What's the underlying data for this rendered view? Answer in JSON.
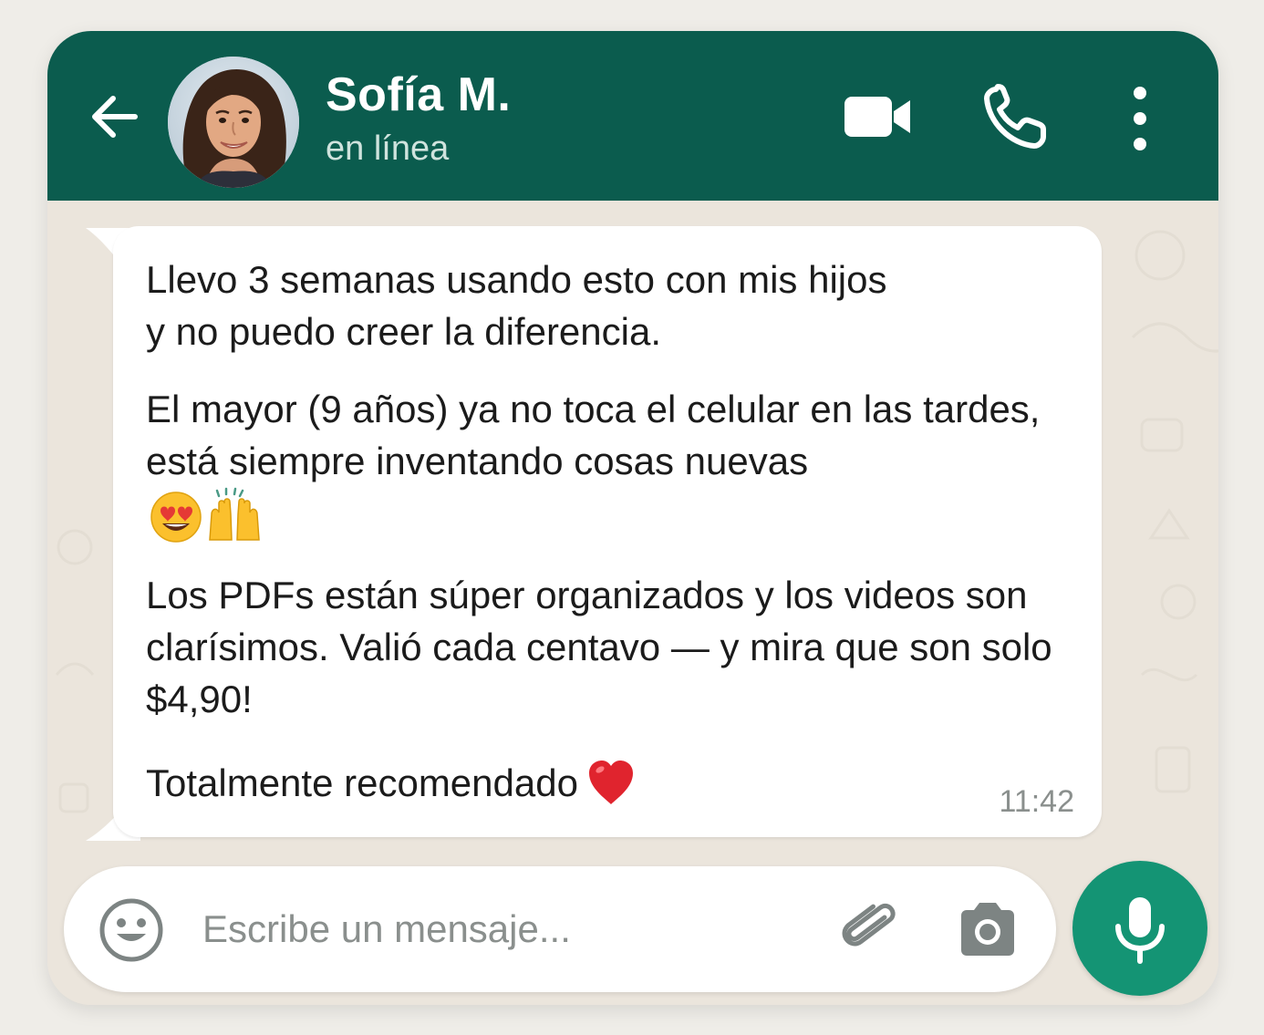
{
  "header": {
    "contact_name": "Sofía M.",
    "status": "en línea",
    "background_color": "#0b5c4e"
  },
  "icons": {
    "back": "arrow-left-icon",
    "video_call": "video-camera-icon",
    "voice_call": "phone-icon",
    "menu": "more-vertical-icon",
    "emoji": "smiley-icon",
    "attach": "paperclip-icon",
    "camera": "camera-icon",
    "mic": "microphone-icon"
  },
  "message": {
    "paragraphs": [
      "Llevo 3 semanas usando esto con mis hijos\ny no puedo creer la diferencia.",
      "El mayor (9 años) ya no toca el celular en las tardes, está siempre inventando cosas nuevas",
      "Los PDFs están súper organizados y los videos son clarísimos. Valió cada centavo — y mira que son solo $4,90!",
      "Totalmente recomendado"
    ],
    "emojis": [
      "heart-eyes-emoji",
      "raising-hands-emoji",
      "red-heart-emoji"
    ],
    "time": "11:42"
  },
  "composer": {
    "placeholder": "Escribe un mensaje...",
    "value": ""
  },
  "colors": {
    "header": "#0b5c4e",
    "mic_button": "#149474",
    "chat_background": "#ebe5dc",
    "bubble": "#ffffff"
  }
}
